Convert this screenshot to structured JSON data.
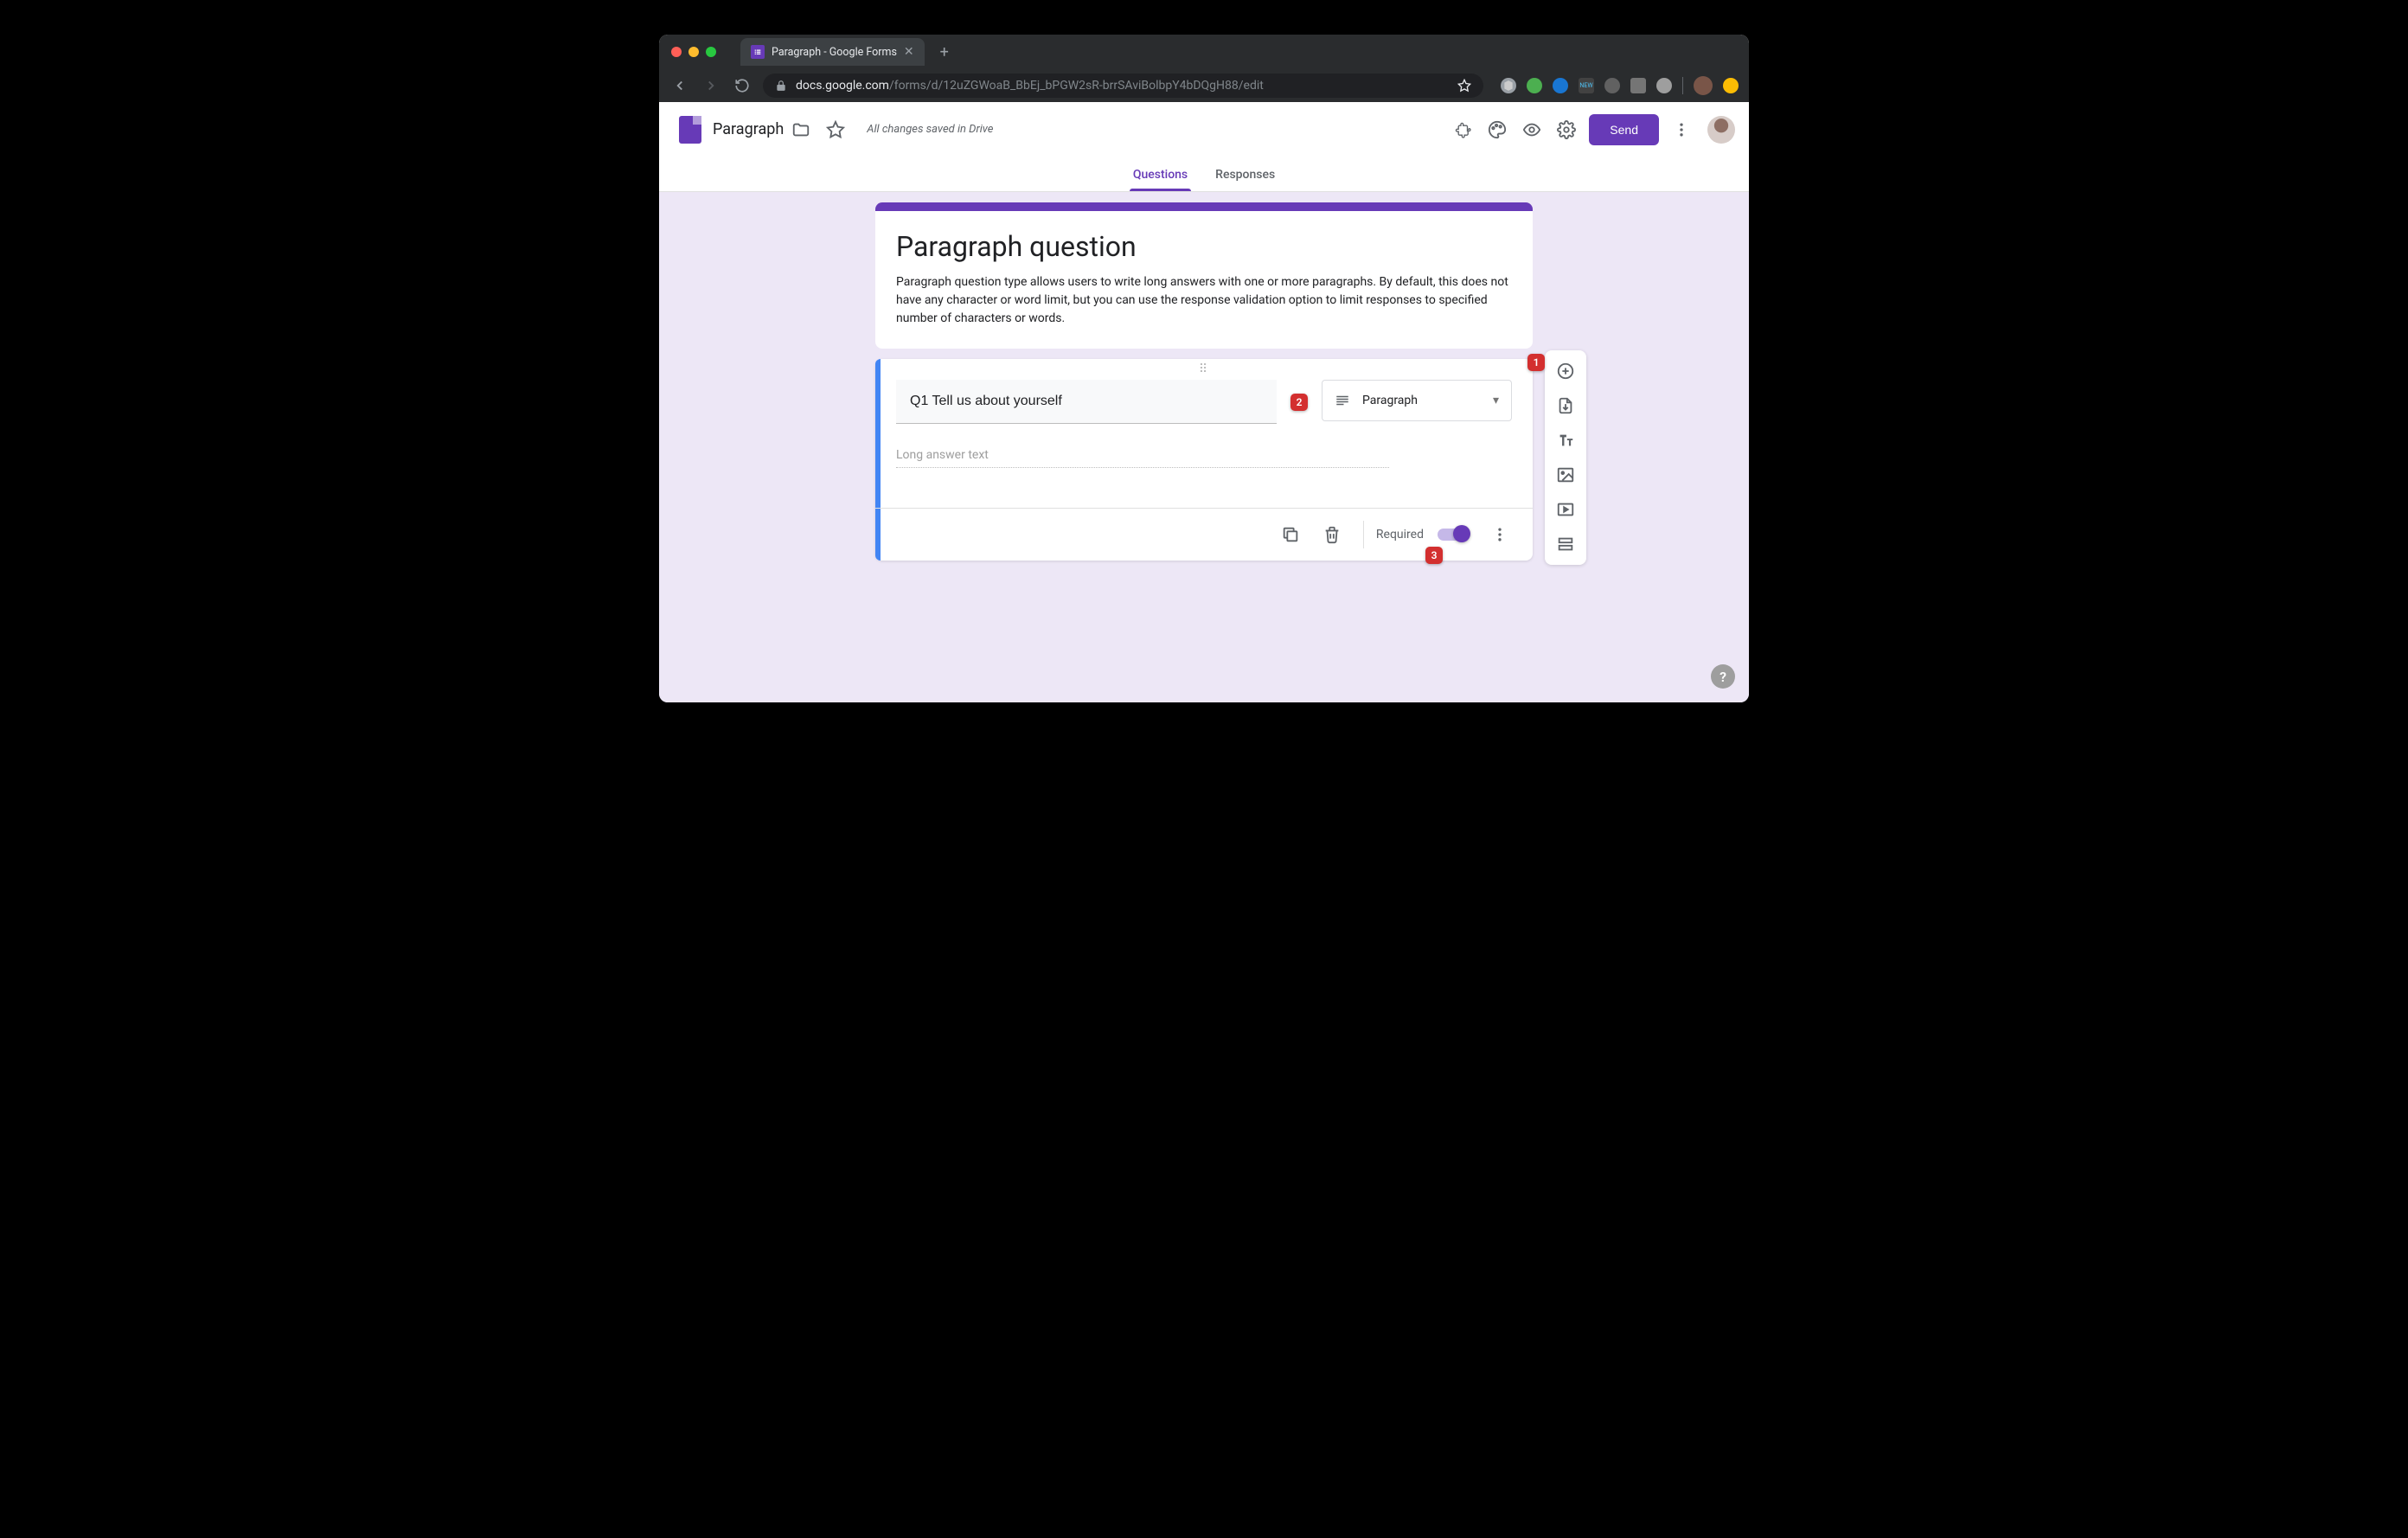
{
  "browser": {
    "tab_title": "Paragraph - Google Forms",
    "url_domain": "docs.google.com",
    "url_path": "/forms/d/12uZGWoaB_BbEj_bPGW2sR-brrSAviBolbpY4bDQgH88/edit"
  },
  "header": {
    "doc_title": "Paragraph",
    "save_status": "All changes saved in Drive",
    "send_label": "Send"
  },
  "tabs": {
    "questions": "Questions",
    "responses": "Responses"
  },
  "form_header": {
    "title": "Paragraph question",
    "description": "Paragraph question type allows users to write long answers with one or more paragraphs. By default, this does not have any character or word limit, but you can use the response validation option to limit responses to specified number of characters or words."
  },
  "question": {
    "title": "Q1 Tell us about yourself",
    "type_label": "Paragraph",
    "answer_placeholder": "Long answer text",
    "required_label": "Required",
    "required_on": true
  },
  "annotations": {
    "a1": "1",
    "a2": "2",
    "a3": "3"
  }
}
